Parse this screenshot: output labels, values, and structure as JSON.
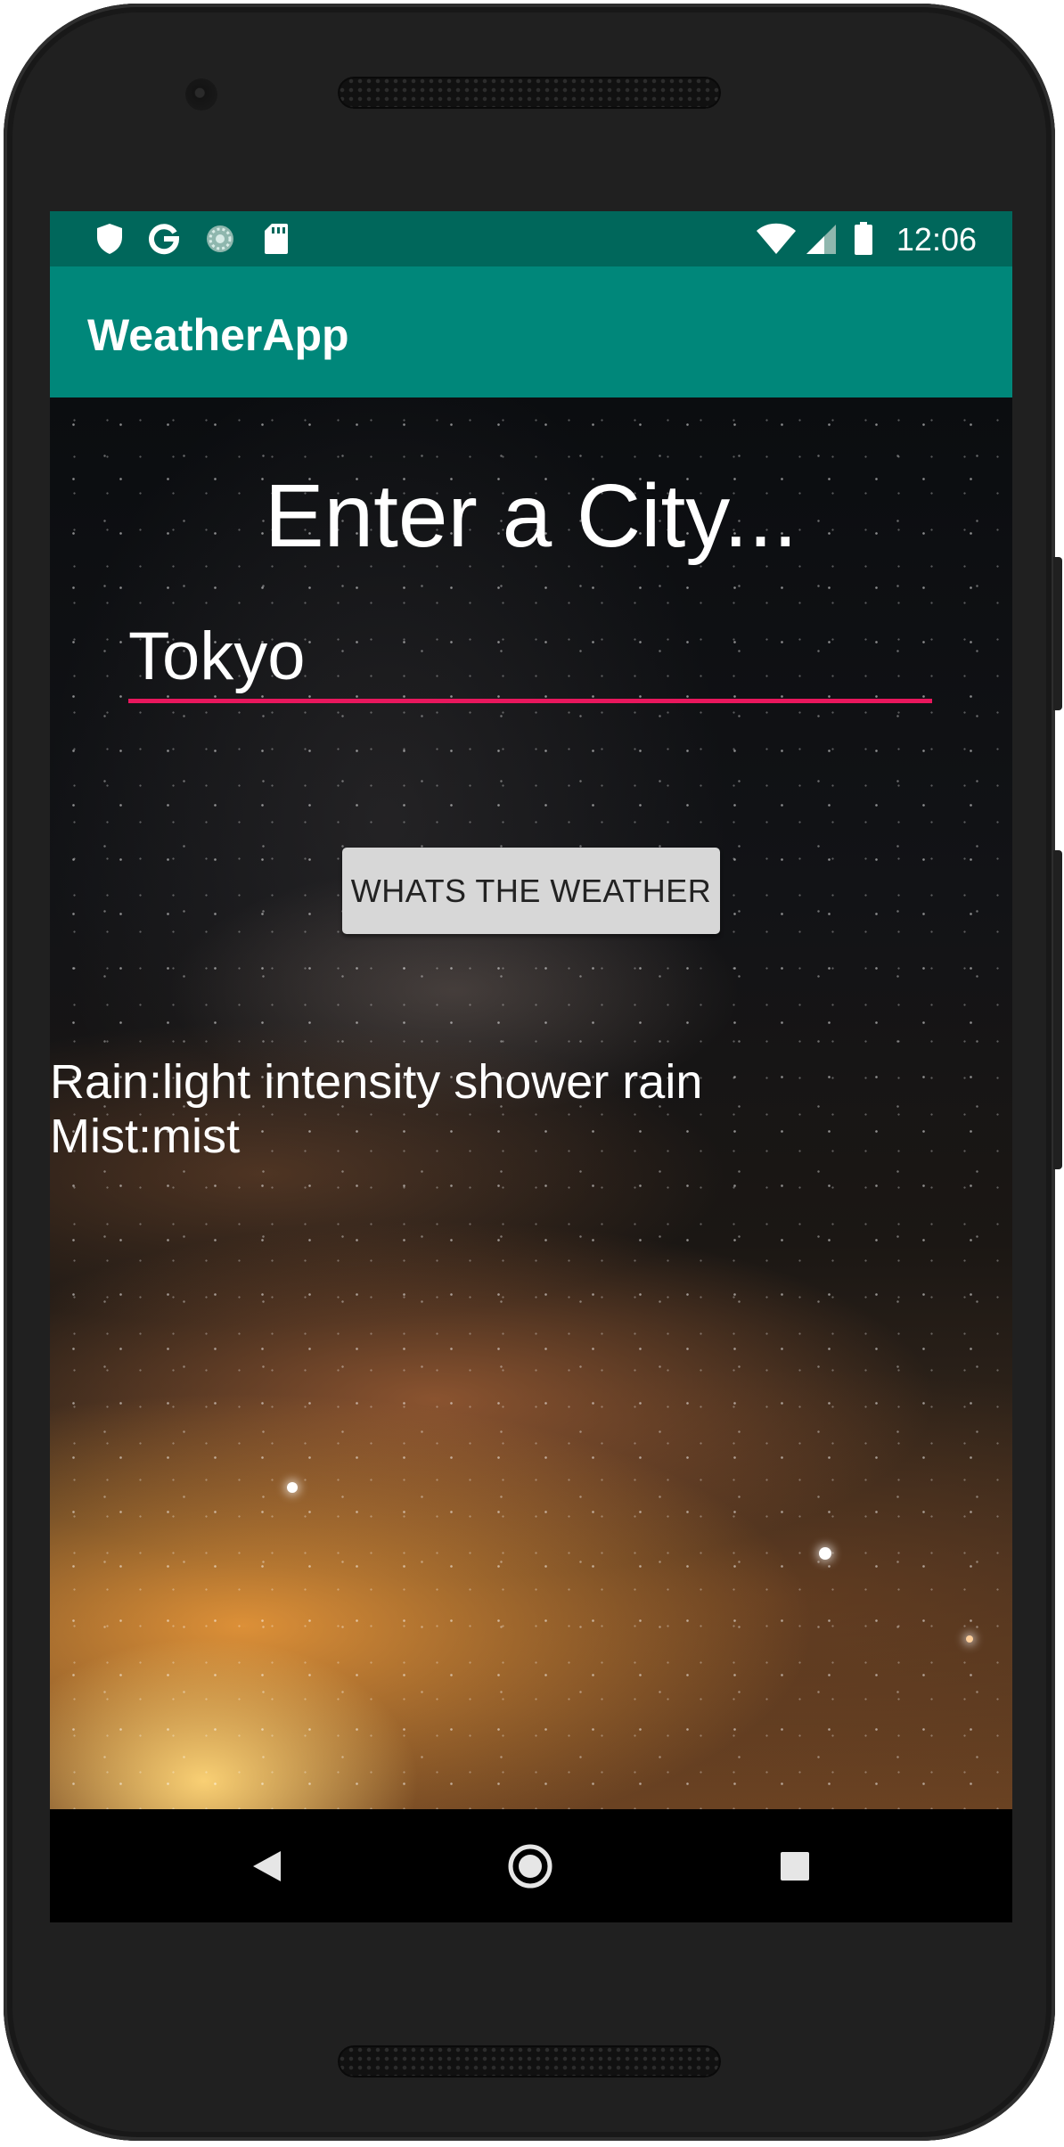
{
  "status_bar": {
    "time": "12:06",
    "left_icons": [
      "shield-icon",
      "google-icon",
      "sync-icon",
      "sd-card-icon"
    ],
    "right_icons": [
      "wifi-icon",
      "signal-icon",
      "battery-icon"
    ],
    "background": "#00675b"
  },
  "app_bar": {
    "title": "WeatherApp",
    "background": "#00877a"
  },
  "main": {
    "heading": "Enter a City...",
    "city_input": {
      "value": "Tokyo",
      "underline_color": "#e8175d"
    },
    "weather_button_label": "WHATS THE WEATHER",
    "results": [
      "Rain:light intensity shower rain",
      "Mist:mist"
    ]
  },
  "nav_bar": {
    "buttons": [
      "back-icon",
      "home-icon",
      "recents-icon"
    ]
  }
}
